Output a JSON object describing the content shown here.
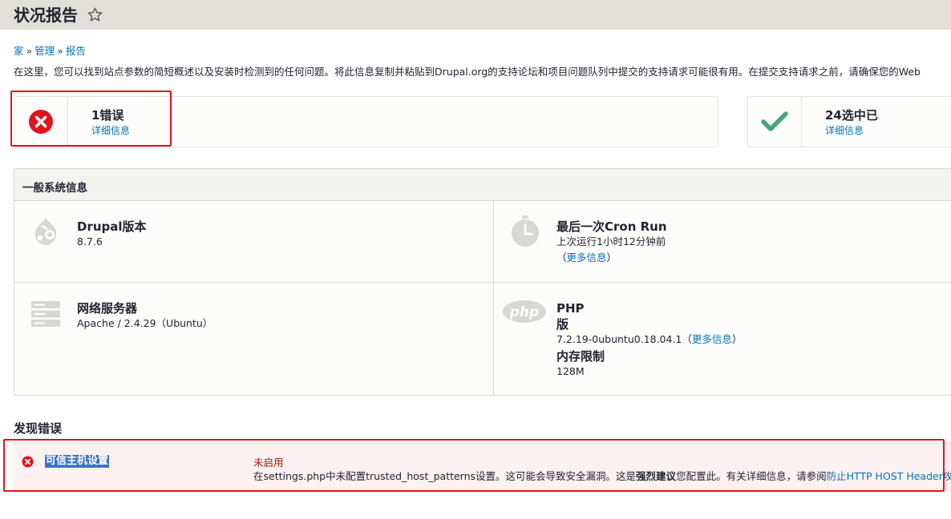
{
  "header": {
    "title": "状况报告",
    "star_icon": "star-outline-icon"
  },
  "breadcrumb": {
    "items": [
      "家",
      "管理",
      "报告"
    ],
    "separator": "»"
  },
  "intro": "在这里，您可以找到站点参数的简短概述以及安装时检测到的任何问题。将此信息复制并粘贴到Drupal.org的支持论坛和项目问题队列中提交的支持请求可能很有用。在提交支持请求之前，请确保您的Web",
  "counters": {
    "error": {
      "title": "1错误",
      "details": "详细信息",
      "icon": "error-x-icon"
    },
    "ok": {
      "title": "24选中已",
      "details": "详细信息",
      "icon": "checkmark-icon"
    }
  },
  "general": {
    "heading": "一般系统信息",
    "drupal": {
      "title": "Drupal版本",
      "value": "8.7.6",
      "icon": "drupal-logo-icon"
    },
    "cron": {
      "title": "最后一次Cron Run",
      "last_run": "上次运行1小时12分钟前",
      "more_open": "（",
      "more_link": "更多信息",
      "more_close": "）",
      "icon": "clock-icon"
    },
    "webserver": {
      "title": "网络服务器",
      "value": "Apache / 2.4.29（Ubuntu）",
      "icon": "server-icon"
    },
    "php": {
      "title": "PHP",
      "version_label": "版",
      "version_value": "7.2.19-0ubuntu0.18.04.1",
      "more_open": "（",
      "more_link": "更多信息",
      "more_close": "）",
      "memory_label": "内存限制",
      "memory_value": "128M",
      "icon": "php-logo-icon"
    }
  },
  "errors": {
    "heading": "发现错误",
    "items": [
      {
        "name": "可信主机设置",
        "status": "未启用",
        "desc_1": "在settings.php中未配置trusted_host_patterns设置。这可能会导致安全漏洞。这是",
        "desc_strong": "强烈建议",
        "desc_2": "您配置此。有关详细信息，请参阅",
        "desc_link": "防止HTTP HOST Header攻击",
        "desc_end": "。",
        "icon": "error-x-icon"
      }
    ]
  },
  "colors": {
    "header_bg": "#e0e0d8",
    "link": "#0074bd",
    "error_red": "#e0141e",
    "ok_green": "#42a877",
    "highlight": "#e0141e"
  }
}
